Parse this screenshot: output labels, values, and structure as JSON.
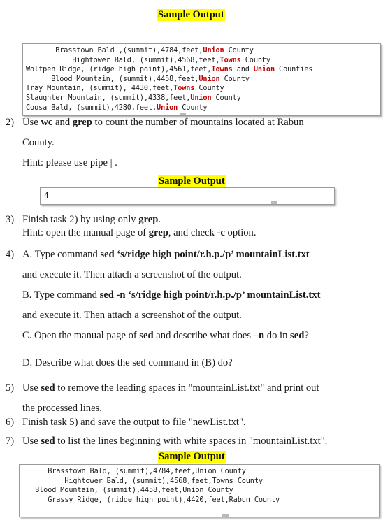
{
  "document": {
    "title": "Sample Output",
    "highlight_color": "#ffff00",
    "code_highlight_color": "#c00000"
  },
  "sample_headings": {
    "first": "Sample Output",
    "second": "Sample Output",
    "third": "Sample Output"
  },
  "output_block_1": {
    "lines": [
      [
        {
          "t": "       Brasstown Bald ,(summit),4784,feet,"
        },
        {
          "t": "Union",
          "c": "red"
        },
        {
          "t": " County"
        }
      ],
      [
        {
          "t": "           Hightower Bald, (summit),4568,feet,"
        },
        {
          "t": "Towns",
          "c": "red"
        },
        {
          "t": " County"
        }
      ],
      [
        {
          "t": "Wolfpen Ridge, (ridge high point),4561,feet,"
        },
        {
          "t": "Towns",
          "c": "red"
        },
        {
          "t": " and "
        },
        {
          "t": "Union",
          "c": "red"
        },
        {
          "t": " Counties"
        }
      ],
      [
        {
          "t": "      Blood Mountain, (summit),4458,feet,"
        },
        {
          "t": "Union",
          "c": "red"
        },
        {
          "t": " County"
        }
      ],
      [
        {
          "t": "Tray Mountain, (summit), 4430,feet,"
        },
        {
          "t": "Towns",
          "c": "red"
        },
        {
          "t": " County"
        }
      ],
      [
        {
          "t": "Slaughter Mountain, (summit),4338,feet,"
        },
        {
          "t": "Union",
          "c": "red"
        },
        {
          "t": " County"
        }
      ],
      [
        {
          "t": "Coosa Bald, (summit),4280,feet,"
        },
        {
          "t": "Union",
          "c": "red"
        },
        {
          "t": " County"
        }
      ]
    ]
  },
  "output_block_2": {
    "lines": [
      [
        {
          "t": "4"
        }
      ]
    ]
  },
  "output_block_3": {
    "lines": [
      [
        {
          "t": "      Brasstown Bald, (summit),4784,feet,Union County"
        }
      ],
      [
        {
          "t": "          Hightower Bald, (summit),4568,feet,Towns County"
        }
      ],
      [
        {
          "t": "   Blood Mountain, (summit),4458,feet,Union County"
        }
      ],
      [
        {
          "t": "      Grassy Ridge, (ridge high point),4420,feet,Rabun County"
        }
      ]
    ]
  },
  "tasks": {
    "t2": {
      "number": "2)",
      "line1_a": "Use ",
      "line1_b": "wc",
      "line1_c": " and ",
      "line1_d": "grep",
      "line1_e": " to count the number of mountains located at Rabun",
      "line2": "County.",
      "line3": "Hint: please use pipe | ."
    },
    "t3": {
      "number": "3)",
      "line1_a": "Finish task 2) by using only ",
      "line1_b": "grep",
      "line1_c": ".",
      "line2_a": "Hint: open the manual page of ",
      "line2_b": "grep",
      "line2_c": ", and check ",
      "line2_d": "-c",
      "line2_e": " option."
    },
    "t4": {
      "number": "4)",
      "a_prefix": "A. Type command ",
      "a_command": "sed ‘s/ridge high point/r.h.p./p’ mountainList.txt",
      "a_follow": "and execute it. Then attach a screenshot of the output.",
      "b_prefix": "B. Type command ",
      "b_command": "sed -n ‘s/ridge high point/r.h.p./p’ mountainList.txt",
      "b_follow": "and execute it. Then attach a screenshot of the output.",
      "c_a": "C. Open the manual page of ",
      "c_b": "sed",
      "c_c": " and describe what does –",
      "c_d": "n",
      "c_e": " do in ",
      "c_f": "sed",
      "c_g": "?",
      "d": "D. Describe what does the sed command in (B) do?"
    },
    "t5": {
      "number": "5)",
      "line1_a": "Use ",
      "line1_b": "sed",
      "line1_c": " to remove the leading spaces in \"mountainList.txt\" and print out",
      "line2": "the processed lines."
    },
    "t6": {
      "number": "6)",
      "line1": "Finish task 5) and save the output to file \"newList.txt\"."
    },
    "t7": {
      "number": "7)",
      "line1_a": "Use ",
      "line1_b": "sed",
      "line1_c": " to list the lines beginning with white spaces in \"mountainList.txt\"."
    }
  }
}
